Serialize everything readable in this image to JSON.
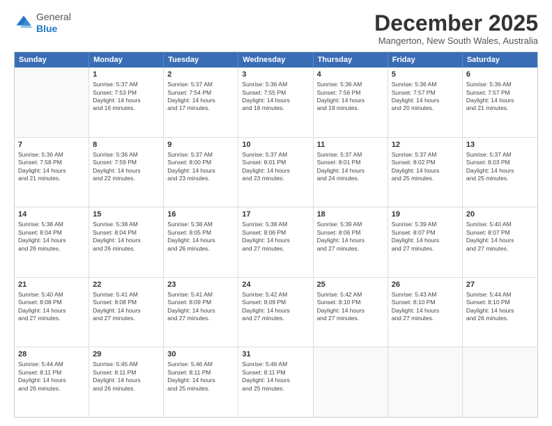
{
  "logo": {
    "general": "General",
    "blue": "Blue"
  },
  "title": "December 2025",
  "location": "Mangerton, New South Wales, Australia",
  "header_days": [
    "Sunday",
    "Monday",
    "Tuesday",
    "Wednesday",
    "Thursday",
    "Friday",
    "Saturday"
  ],
  "rows": [
    [
      {
        "day": "",
        "info": ""
      },
      {
        "day": "1",
        "info": "Sunrise: 5:37 AM\nSunset: 7:53 PM\nDaylight: 14 hours\nand 16 minutes."
      },
      {
        "day": "2",
        "info": "Sunrise: 5:37 AM\nSunset: 7:54 PM\nDaylight: 14 hours\nand 17 minutes."
      },
      {
        "day": "3",
        "info": "Sunrise: 5:36 AM\nSunset: 7:55 PM\nDaylight: 14 hours\nand 18 minutes."
      },
      {
        "day": "4",
        "info": "Sunrise: 5:36 AM\nSunset: 7:56 PM\nDaylight: 14 hours\nand 19 minutes."
      },
      {
        "day": "5",
        "info": "Sunrise: 5:36 AM\nSunset: 7:57 PM\nDaylight: 14 hours\nand 20 minutes."
      },
      {
        "day": "6",
        "info": "Sunrise: 5:36 AM\nSunset: 7:57 PM\nDaylight: 14 hours\nand 21 minutes."
      }
    ],
    [
      {
        "day": "7",
        "info": "Sunrise: 5:36 AM\nSunset: 7:58 PM\nDaylight: 14 hours\nand 21 minutes."
      },
      {
        "day": "8",
        "info": "Sunrise: 5:36 AM\nSunset: 7:59 PM\nDaylight: 14 hours\nand 22 minutes."
      },
      {
        "day": "9",
        "info": "Sunrise: 5:37 AM\nSunset: 8:00 PM\nDaylight: 14 hours\nand 23 minutes."
      },
      {
        "day": "10",
        "info": "Sunrise: 5:37 AM\nSunset: 8:01 PM\nDaylight: 14 hours\nand 23 minutes."
      },
      {
        "day": "11",
        "info": "Sunrise: 5:37 AM\nSunset: 8:01 PM\nDaylight: 14 hours\nand 24 minutes."
      },
      {
        "day": "12",
        "info": "Sunrise: 5:37 AM\nSunset: 8:02 PM\nDaylight: 14 hours\nand 25 minutes."
      },
      {
        "day": "13",
        "info": "Sunrise: 5:37 AM\nSunset: 8:03 PM\nDaylight: 14 hours\nand 25 minutes."
      }
    ],
    [
      {
        "day": "14",
        "info": "Sunrise: 5:38 AM\nSunset: 8:04 PM\nDaylight: 14 hours\nand 26 minutes."
      },
      {
        "day": "15",
        "info": "Sunrise: 5:38 AM\nSunset: 8:04 PM\nDaylight: 14 hours\nand 26 minutes."
      },
      {
        "day": "16",
        "info": "Sunrise: 5:38 AM\nSunset: 8:05 PM\nDaylight: 14 hours\nand 26 minutes."
      },
      {
        "day": "17",
        "info": "Sunrise: 5:38 AM\nSunset: 8:06 PM\nDaylight: 14 hours\nand 27 minutes."
      },
      {
        "day": "18",
        "info": "Sunrise: 5:39 AM\nSunset: 8:06 PM\nDaylight: 14 hours\nand 27 minutes."
      },
      {
        "day": "19",
        "info": "Sunrise: 5:39 AM\nSunset: 8:07 PM\nDaylight: 14 hours\nand 27 minutes."
      },
      {
        "day": "20",
        "info": "Sunrise: 5:40 AM\nSunset: 8:07 PM\nDaylight: 14 hours\nand 27 minutes."
      }
    ],
    [
      {
        "day": "21",
        "info": "Sunrise: 5:40 AM\nSunset: 8:08 PM\nDaylight: 14 hours\nand 27 minutes."
      },
      {
        "day": "22",
        "info": "Sunrise: 5:41 AM\nSunset: 8:08 PM\nDaylight: 14 hours\nand 27 minutes."
      },
      {
        "day": "23",
        "info": "Sunrise: 5:41 AM\nSunset: 8:09 PM\nDaylight: 14 hours\nand 27 minutes."
      },
      {
        "day": "24",
        "info": "Sunrise: 5:42 AM\nSunset: 8:09 PM\nDaylight: 14 hours\nand 27 minutes."
      },
      {
        "day": "25",
        "info": "Sunrise: 5:42 AM\nSunset: 8:10 PM\nDaylight: 14 hours\nand 27 minutes."
      },
      {
        "day": "26",
        "info": "Sunrise: 5:43 AM\nSunset: 8:10 PM\nDaylight: 14 hours\nand 27 minutes."
      },
      {
        "day": "27",
        "info": "Sunrise: 5:44 AM\nSunset: 8:10 PM\nDaylight: 14 hours\nand 26 minutes."
      }
    ],
    [
      {
        "day": "28",
        "info": "Sunrise: 5:44 AM\nSunset: 8:11 PM\nDaylight: 14 hours\nand 26 minutes."
      },
      {
        "day": "29",
        "info": "Sunrise: 5:45 AM\nSunset: 8:11 PM\nDaylight: 14 hours\nand 26 minutes."
      },
      {
        "day": "30",
        "info": "Sunrise: 5:46 AM\nSunset: 8:11 PM\nDaylight: 14 hours\nand 25 minutes."
      },
      {
        "day": "31",
        "info": "Sunrise: 5:46 AM\nSunset: 8:11 PM\nDaylight: 14 hours\nand 25 minutes."
      },
      {
        "day": "",
        "info": ""
      },
      {
        "day": "",
        "info": ""
      },
      {
        "day": "",
        "info": ""
      }
    ]
  ]
}
